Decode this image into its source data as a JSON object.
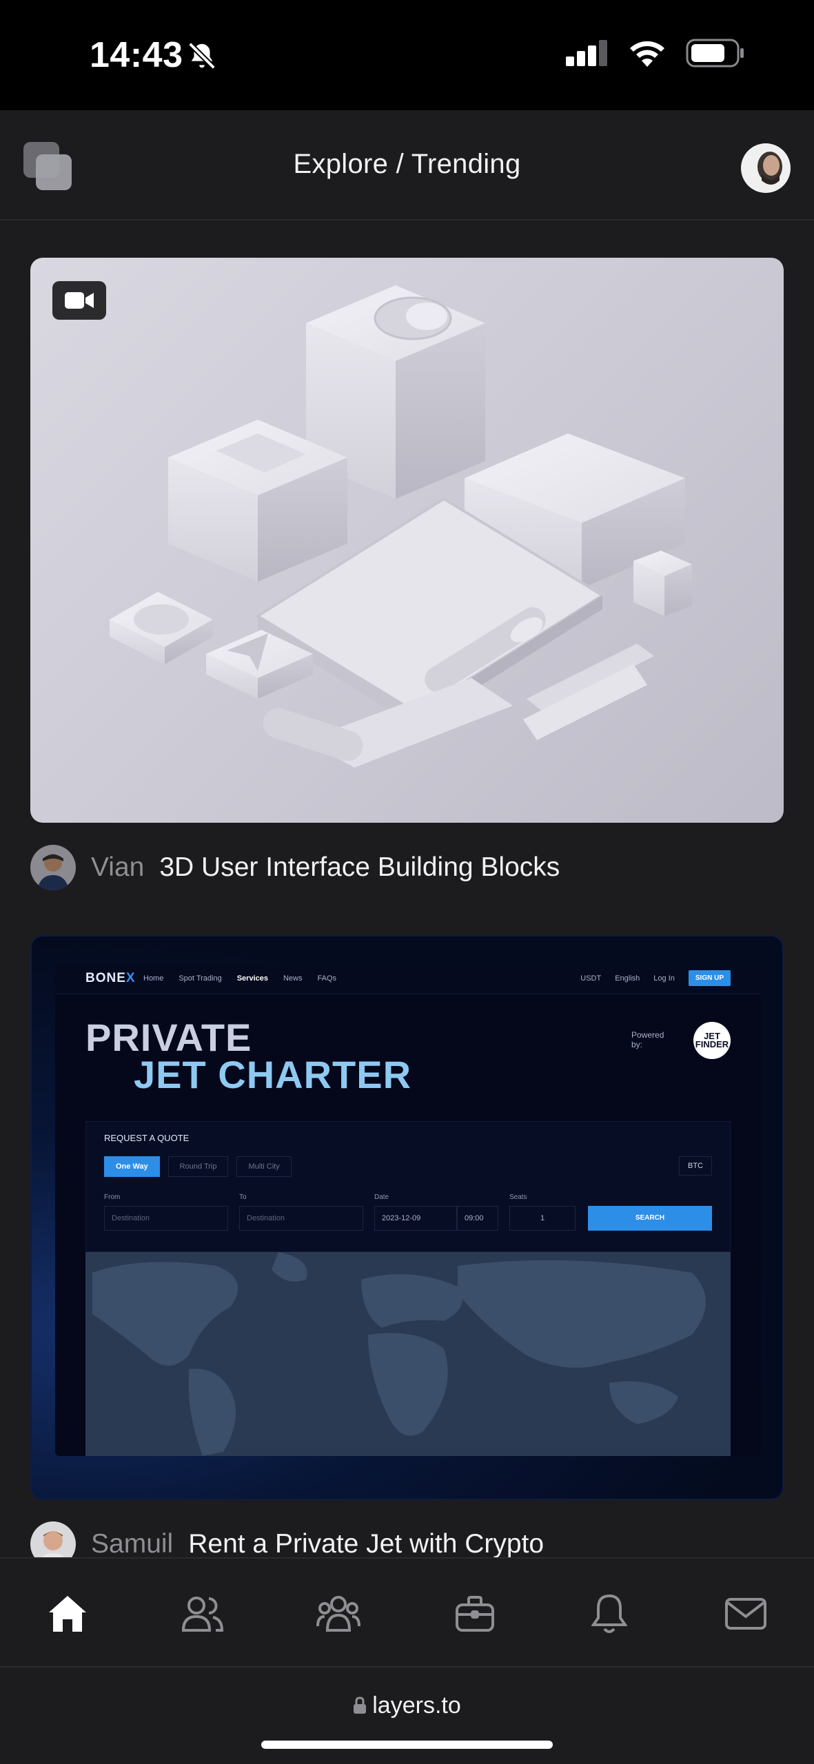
{
  "status_bar": {
    "time": "14:43"
  },
  "header": {
    "title": "Explore / Trending"
  },
  "posts": [
    {
      "user": "Vian",
      "title": "3D User Interface Building Blocks",
      "media_type": "video"
    },
    {
      "user": "Samuil",
      "title": "Rent a Private Jet with Crypto",
      "media_type": "image"
    }
  ],
  "jet_site": {
    "brand_a": "BONE",
    "brand_b": "X",
    "nav": [
      "Home",
      "Spot Trading",
      "Services",
      "News",
      "FAQs"
    ],
    "currency": "USDT",
    "language": "English",
    "login": "Log In",
    "signup": "SIGN UP",
    "hero_line1": "PRIVATE",
    "hero_line2": "JET CHARTER",
    "powered_by": "Powered by:",
    "partner_logo": "JET FINDER",
    "quote_title": "REQUEST A QUOTE",
    "trip_tabs": [
      "One Way",
      "Round Trip",
      "Multi City"
    ],
    "pay_currency": "BTC",
    "labels": {
      "from": "From",
      "to": "To",
      "date": "Date",
      "seats": "Seats"
    },
    "from_placeholder": "Destination",
    "to_placeholder": "Destination",
    "date_value": "2023-12-09",
    "time_value": "09:00",
    "seats_value": "1",
    "search": "SEARCH"
  },
  "tab_bar": [
    "home-icon",
    "users-icon",
    "community-icon",
    "briefcase-icon",
    "bell-icon",
    "mail-icon"
  ],
  "browser": {
    "url": "layers.to"
  }
}
